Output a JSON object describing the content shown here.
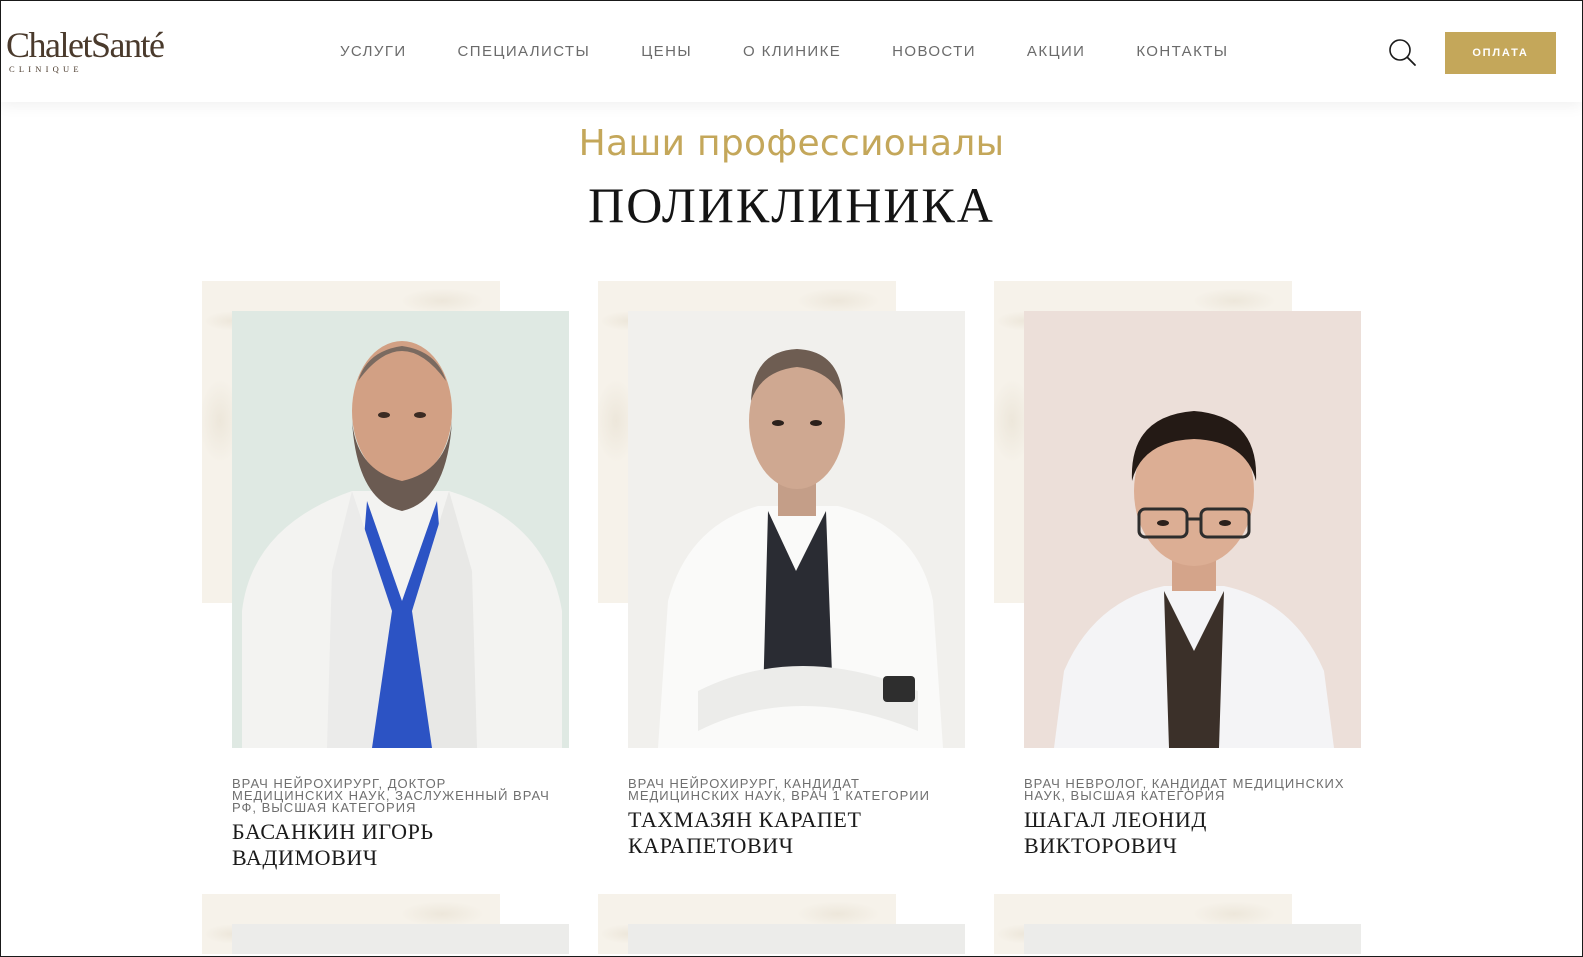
{
  "header": {
    "logo_main": "ChaletSanté",
    "logo_sub": "CLINIQUE",
    "nav": [
      "УСЛУГИ",
      "СПЕЦИАЛИСТЫ",
      "ЦЕНЫ",
      "О КЛИНИКЕ",
      "НОВОСТИ",
      "АКЦИИ",
      "КОНТАКТЫ"
    ],
    "search_icon": "search-icon",
    "pay_label": "ОПЛАТА"
  },
  "section": {
    "subtitle": "Наши профессионалы",
    "title": "ПОЛИКЛИНИКА"
  },
  "doctors": [
    {
      "role": "ВРАЧ НЕЙРОХИРУРГ, ДОКТОР МЕДИЦИНСКИХ НАУК, ЗАСЛУЖЕННЫЙ ВРАЧ РФ, ВЫСШАЯ КАТЕГОРИЯ",
      "name": "БАСАНКИН ИГОРЬ ВАДИМОВИЧ"
    },
    {
      "role": "ВРАЧ НЕЙРОХИРУРГ, КАНДИДАТ МЕДИЦИНСКИХ НАУК, ВРАЧ 1 КАТЕГОРИИ",
      "name": "ТАХМАЗЯН КАРАПЕТ КАРАПЕТОВИЧ"
    },
    {
      "role": "ВРАЧ НЕВРОЛОГ, КАНДИДАТ МЕДИЦИНСКИХ НАУК, ВЫСШАЯ КАТЕГОРИЯ",
      "name": "ШАГАЛ ЛЕОНИД ВИКТОРОВИЧ"
    }
  ],
  "colors": {
    "accent": "#c4a75a",
    "nav_text": "#6b6b6b",
    "title_text": "#141414"
  }
}
